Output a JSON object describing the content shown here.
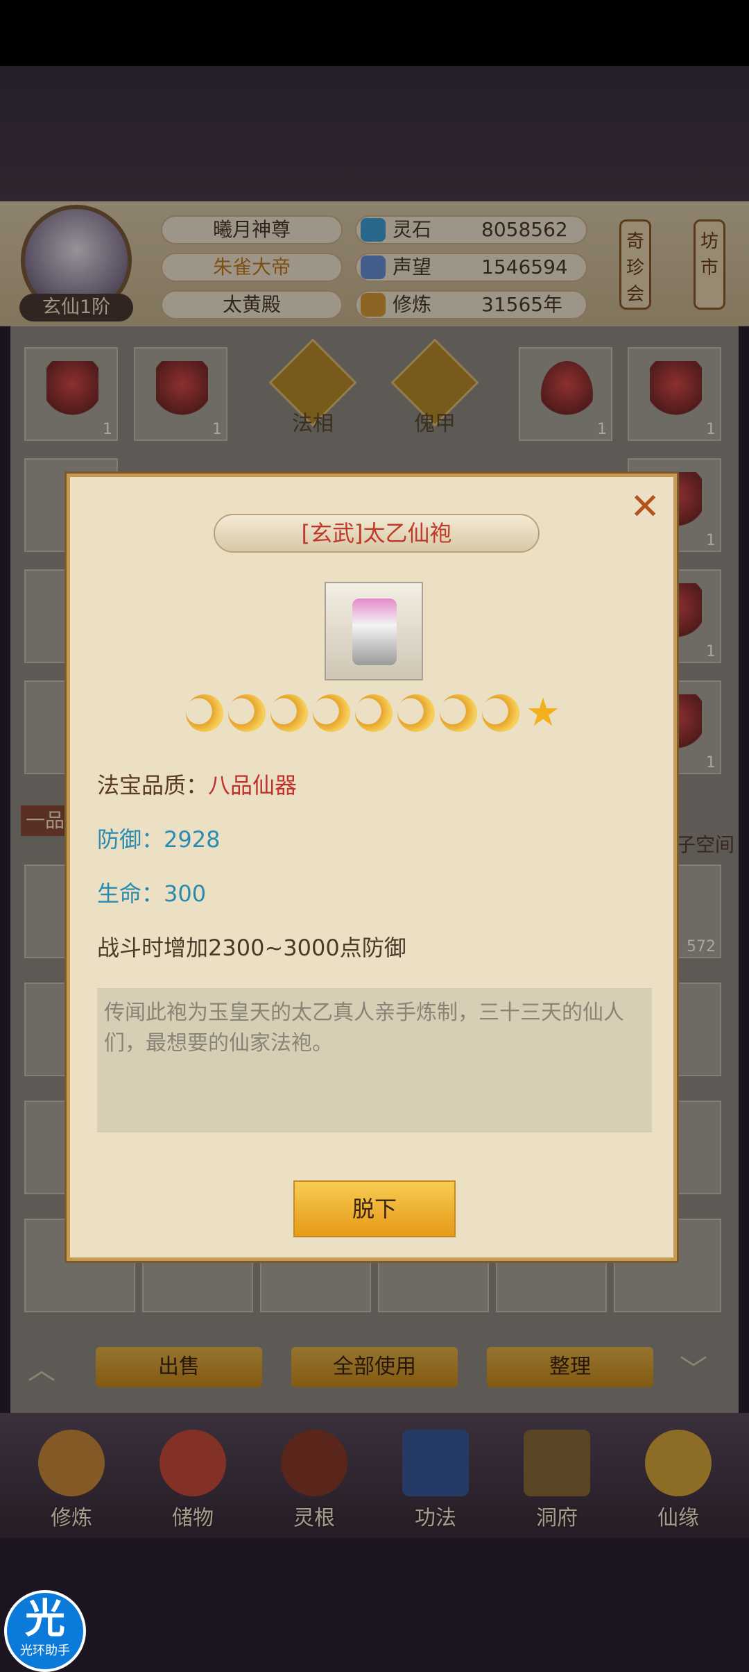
{
  "header": {
    "rank": "玄仙1阶",
    "titles": [
      "曦月神尊",
      "朱雀大帝",
      "太黄殿"
    ],
    "resources": [
      {
        "label": "灵石",
        "value": "8058562",
        "icon": "spirit-stone-icon",
        "color": "#3f9fd6"
      },
      {
        "label": "声望",
        "value": "1546594",
        "icon": "reputation-icon",
        "color": "#6b8fd6"
      },
      {
        "label": "修炼",
        "value": "31565年",
        "icon": "cultivation-icon",
        "color": "#d89b3a"
      }
    ],
    "side_buttons": [
      "奇珍会",
      "坊市"
    ]
  },
  "grid": {
    "top_row_counts": [
      "1",
      "1",
      "1",
      "1"
    ],
    "top_tabs": [
      "法相",
      "傀甲"
    ],
    "side_counts": [
      "1",
      "1",
      "1",
      "1"
    ],
    "side_label": "子空间",
    "left_tag": "一品",
    "stack_count": "572"
  },
  "bottom_actions": [
    "出售",
    "全部使用",
    "整理"
  ],
  "nav": [
    "修炼",
    "储物",
    "灵根",
    "功法",
    "洞府",
    "仙缘"
  ],
  "modal": {
    "title": "[玄武]太乙仙袍",
    "close": "✕",
    "stars": {
      "moons": 8,
      "suns": 1
    },
    "quality_label": "法宝品质：",
    "quality_value": "八品仙器",
    "defense": "防御：2928",
    "life": "生命：300",
    "effect": "战斗时增加2300~3000点防御",
    "description": "传闻此袍为玉皇天的太乙真人亲手炼制，三十三天的仙人们，最想要的仙家法袍。",
    "action": "脱下"
  },
  "badge": {
    "text": "光环助手",
    "glyph": "光"
  }
}
